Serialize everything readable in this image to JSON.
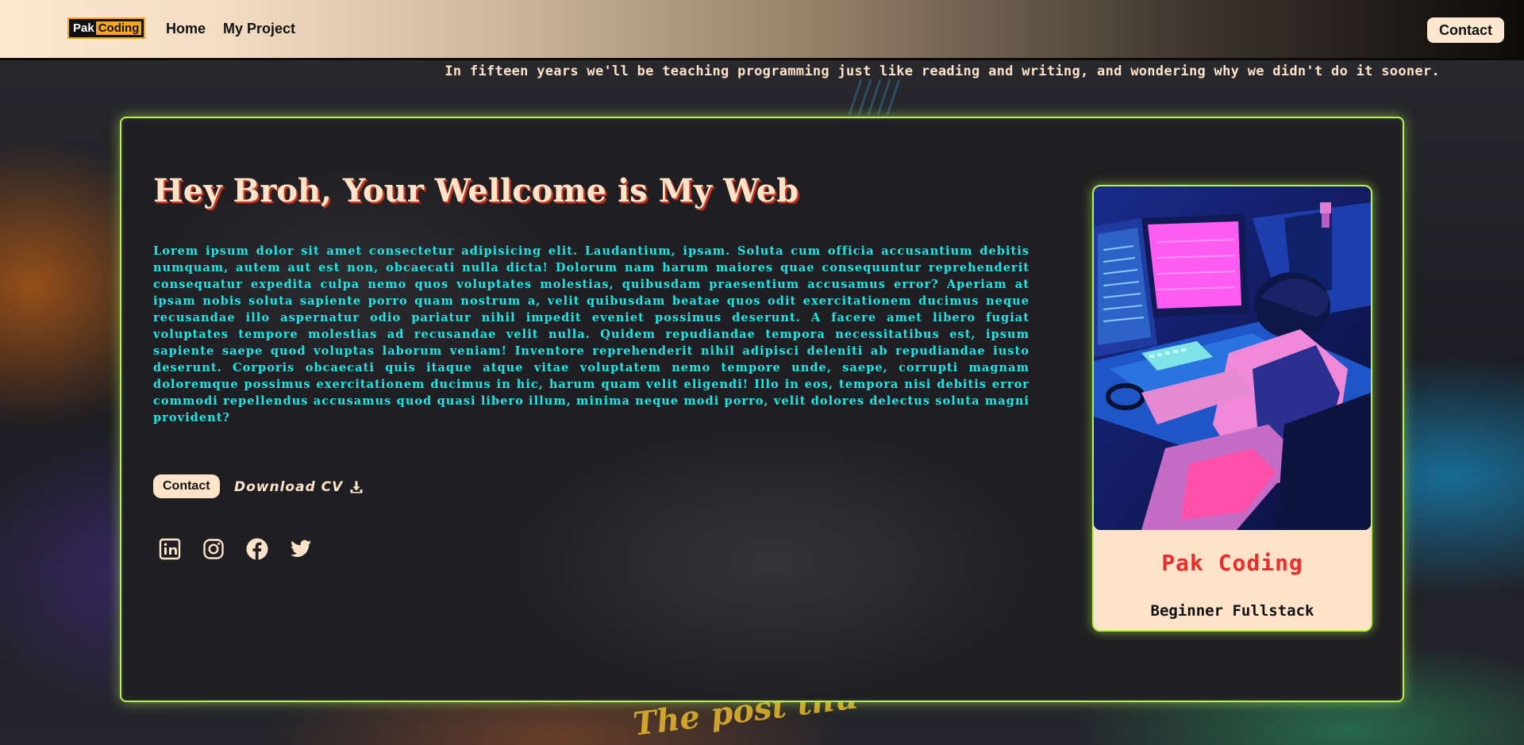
{
  "navbar": {
    "logo_part1": "Pak",
    "logo_part2": "Coding",
    "links": [
      "Home",
      "My Project"
    ],
    "contact_label": "Contact"
  },
  "quote": "In fifteen years we'll be teaching programming just like reading and writing, and wondering why we didn't do it sooner.",
  "hero": {
    "title": "Hey Broh, Your Wellcome is My Web",
    "description": "Lorem ipsum dolor sit amet consectetur adipisicing elit. Laudantium, ipsam. Soluta cum officia accusantium debitis numquam, autem aut est non, obcaecati nulla dicta! Dolorum nam harum maiores quae consequuntur reprehenderit consequatur expedita culpa nemo quos voluptates molestias, quibusdam praesentium accusamus error? Aperiam at ipsam nobis soluta sapiente porro quam nostrum a, velit quibusdam beatae quos odit exercitationem ducimus neque recusandae illo aspernatur odio pariatur nihil impedit eveniet possimus deserunt. A facere amet libero fugiat voluptates tempore molestias ad recusandae velit nulla. Quidem repudiandae tempora necessitatibus est, ipsum sapiente saepe quod voluptas laborum veniam! Inventore reprehenderit nihil adipisci deleniti ab repudiandae iusto deserunt. Corporis obcaecati quis itaque atque vitae voluptatem nemo tempore unde, saepe, corrupti magnam doloremque possimus exercitationem ducimus in hic, harum quam velit eligendi! Illo in eos, tempora nisi debitis error commodi repellendus accusamus quod quasi libero illum, minima neque modi porro, velit dolores delectus soluta magni provident?",
    "contact_button": "Contact",
    "download_button": "Download CV"
  },
  "socials": [
    "linkedin-icon",
    "instagram-icon",
    "facebook-icon",
    "twitter-icon"
  ],
  "profile": {
    "name": "Pak Coding",
    "role": "Beginner Fullstack"
  },
  "background_text": "The post thu",
  "colors": {
    "accent_border": "#b5f24a",
    "cream": "#fde3c8",
    "description_text": "#18e8e8",
    "name_red": "#ef2b2b"
  }
}
